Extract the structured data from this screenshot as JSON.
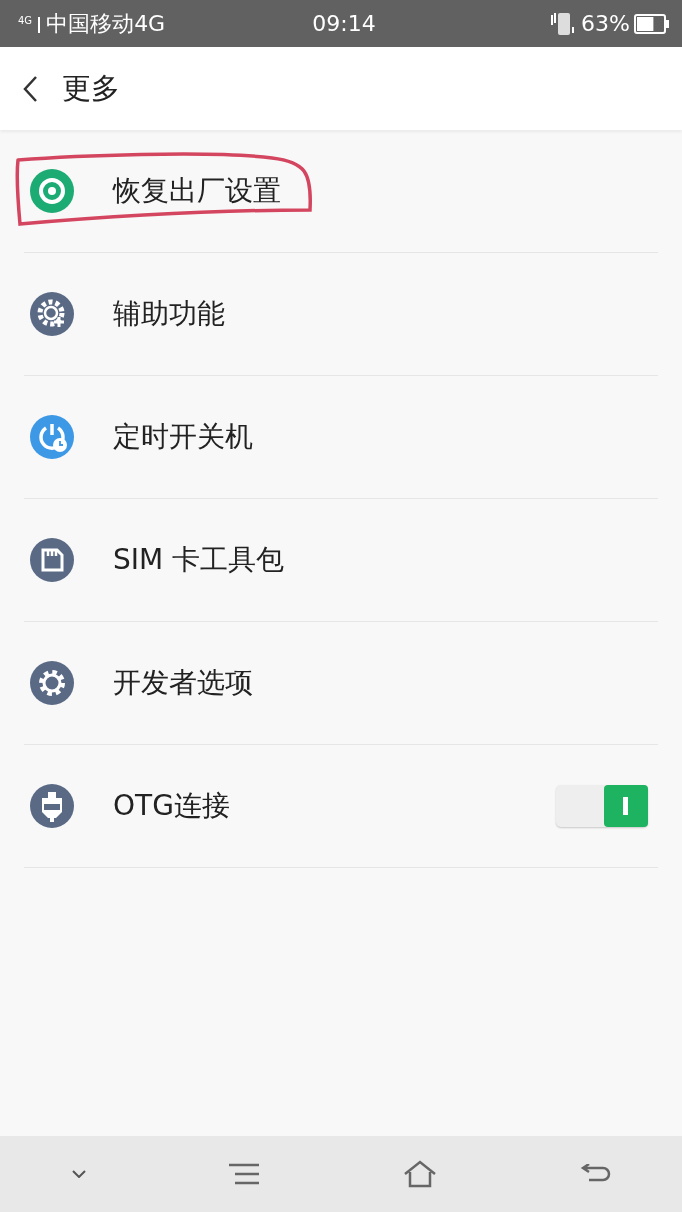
{
  "status_bar": {
    "network_badge": "4G",
    "carrier": "中国移动4G",
    "time": "09:14",
    "battery": {
      "text": "63%",
      "level": 0.63
    }
  },
  "header": {
    "title": "更多"
  },
  "items": [
    {
      "kind": "plain",
      "label": "恢复出厂设置",
      "highlighted": true
    },
    {
      "kind": "plain",
      "label": "辅助功能",
      "highlighted": false
    },
    {
      "kind": "plain",
      "label": "定时开关机",
      "highlighted": false
    },
    {
      "kind": "plain",
      "label": "SIM 卡工具包",
      "highlighted": false
    },
    {
      "kind": "plain",
      "label": "开发者选项",
      "highlighted": false
    },
    {
      "kind": "toggle",
      "label": "OTG连接",
      "highlighted": false,
      "on": true
    }
  ]
}
